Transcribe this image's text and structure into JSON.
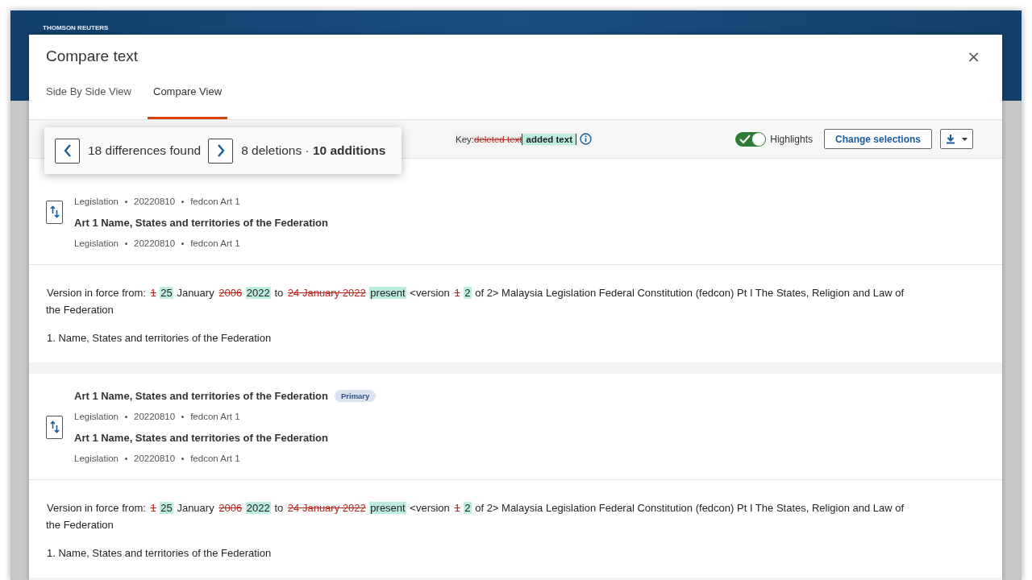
{
  "brand": "THOMSON REUTERS",
  "dialog": {
    "title": "Compare text",
    "close": "×"
  },
  "tabs": [
    {
      "label": "Side By Side View",
      "selected": false
    },
    {
      "label": "Compare View",
      "selected": true
    }
  ],
  "navigator": {
    "count": "18 differences found",
    "summary": "8 deletions · **10 additions**"
  },
  "key": {
    "label": "Key:",
    "deleted": "deleted text",
    "added": "added text"
  },
  "highlights": {
    "label": "Highlights",
    "on": true
  },
  "change_button": "Change selections",
  "sections": [
    {
      "kind": "documents",
      "documents": [
        {
          "meta": [
            "Legislation",
            "20220810",
            "fedcon Art 1"
          ]
        },
        {
          "title": "Art 1 Name, States and territories of the Federation",
          "meta": [
            "Legislation",
            "20220810",
            "fedcon Art 1"
          ]
        }
      ]
    },
    {
      "kind": "text",
      "paragraphs": [
        [
          {
            "kind": "plain",
            "text": "Version in force from:"
          },
          {
            "kind": "deleted",
            "text": "1"
          },
          {
            "kind": "added",
            "text": "25"
          },
          {
            "kind": "plain",
            "text": "January"
          },
          {
            "kind": "deleted",
            "text": "2006"
          },
          {
            "kind": "added",
            "text": "2022"
          },
          {
            "kind": "plain",
            "text": "to"
          },
          {
            "kind": "deleted",
            "text": "24 January 2022"
          },
          {
            "kind": "added",
            "text": "present"
          },
          {
            "kind": "plain",
            "text": "<version"
          },
          {
            "kind": "deleted",
            "text": "1"
          },
          {
            "kind": "added",
            "text": "2"
          },
          {
            "kind": "plain",
            "text": "of 2> Malaysia Legislation Federal Constitution (fedcon) Pt I The States, Religion and Law of the Federation"
          }
        ],
        [
          {
            "kind": "plain",
            "text": "1. Name, States and territories of the Federation"
          }
        ]
      ]
    },
    {
      "kind": "documents",
      "documents": [
        {
          "title": "Art 1 Name, States and territories of the Federation",
          "badge": "Primary",
          "meta": [
            "Legislation",
            "20220810",
            "fedcon Art 1"
          ]
        },
        {
          "title": "Art 1 Name, States and territories of the Federation",
          "meta": [
            "Legislation",
            "20220810",
            "fedcon Art 1"
          ]
        }
      ]
    },
    {
      "kind": "text",
      "paragraphs": [
        [
          {
            "kind": "plain",
            "text": "Version in force from:"
          },
          {
            "kind": "deleted",
            "text": "1"
          },
          {
            "kind": "added",
            "text": "25"
          },
          {
            "kind": "plain",
            "text": "January"
          },
          {
            "kind": "deleted",
            "text": "2006"
          },
          {
            "kind": "added",
            "text": "2022"
          },
          {
            "kind": "plain",
            "text": "to"
          },
          {
            "kind": "deleted",
            "text": "24 January 2022"
          },
          {
            "kind": "added",
            "text": "present"
          },
          {
            "kind": "plain",
            "text": "<version"
          },
          {
            "kind": "deleted",
            "text": "1"
          },
          {
            "kind": "added",
            "text": "2"
          },
          {
            "kind": "plain",
            "text": "of 2> Malaysia Legislation Federal Constitution (fedcon) Pt I The States, Religion and Law of the Federation"
          }
        ],
        [
          {
            "kind": "plain",
            "text": "1. Name, States and territories of the Federation"
          }
        ]
      ]
    }
  ]
}
